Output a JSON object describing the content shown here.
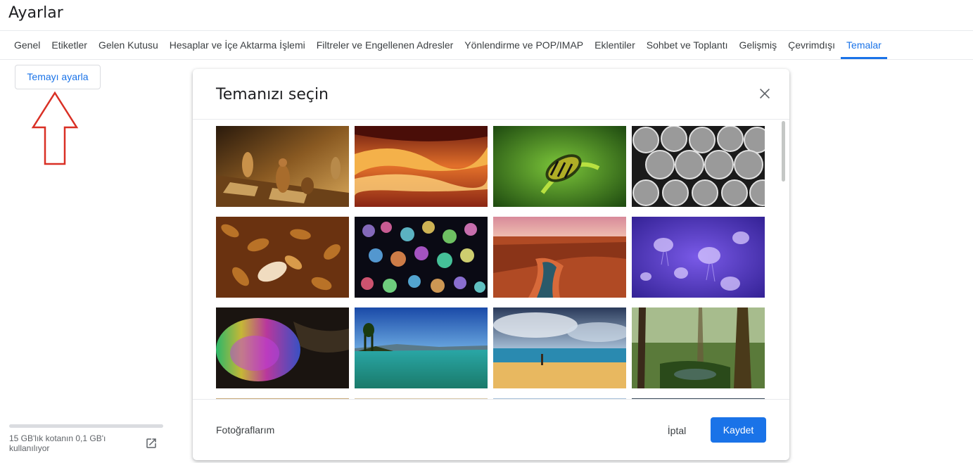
{
  "page": {
    "title": "Ayarlar"
  },
  "tabs": [
    {
      "label": "Genel"
    },
    {
      "label": "Etiketler"
    },
    {
      "label": "Gelen Kutusu"
    },
    {
      "label": "Hesaplar ve İçe Aktarma İşlemi"
    },
    {
      "label": "Filtreler ve Engellenen Adresler"
    },
    {
      "label": "Yönlendirme ve POP/IMAP"
    },
    {
      "label": "Eklentiler"
    },
    {
      "label": "Sohbet ve Toplantı"
    },
    {
      "label": "Gelişmiş"
    },
    {
      "label": "Çevrimdışı"
    },
    {
      "label": "Temalar",
      "active": true
    }
  ],
  "theme_button": {
    "label": "Temayı ayarla"
  },
  "storage": {
    "text": "15 GB'lık kotanın 0,1 GB'ı kullanılıyor",
    "used_fraction": 0.007
  },
  "dialog": {
    "title": "Temanızı seçin",
    "themes": [
      {
        "name": "chess-pieces"
      },
      {
        "name": "red-canyon"
      },
      {
        "name": "caterpillar"
      },
      {
        "name": "metal-pipes"
      },
      {
        "name": "autumn-leaves"
      },
      {
        "name": "bokeh-lights"
      },
      {
        "name": "desert-canyon-river"
      },
      {
        "name": "jellyfish"
      },
      {
        "name": "rainbow-bubble"
      },
      {
        "name": "lake-island"
      },
      {
        "name": "beach-clouds"
      },
      {
        "name": "forest-stream"
      }
    ],
    "my_photos_label": "Fotoğraflarım",
    "cancel_label": "İptal",
    "save_label": "Kaydet"
  },
  "colors": {
    "accent": "#1a73e8",
    "arrow": "#d93025"
  }
}
